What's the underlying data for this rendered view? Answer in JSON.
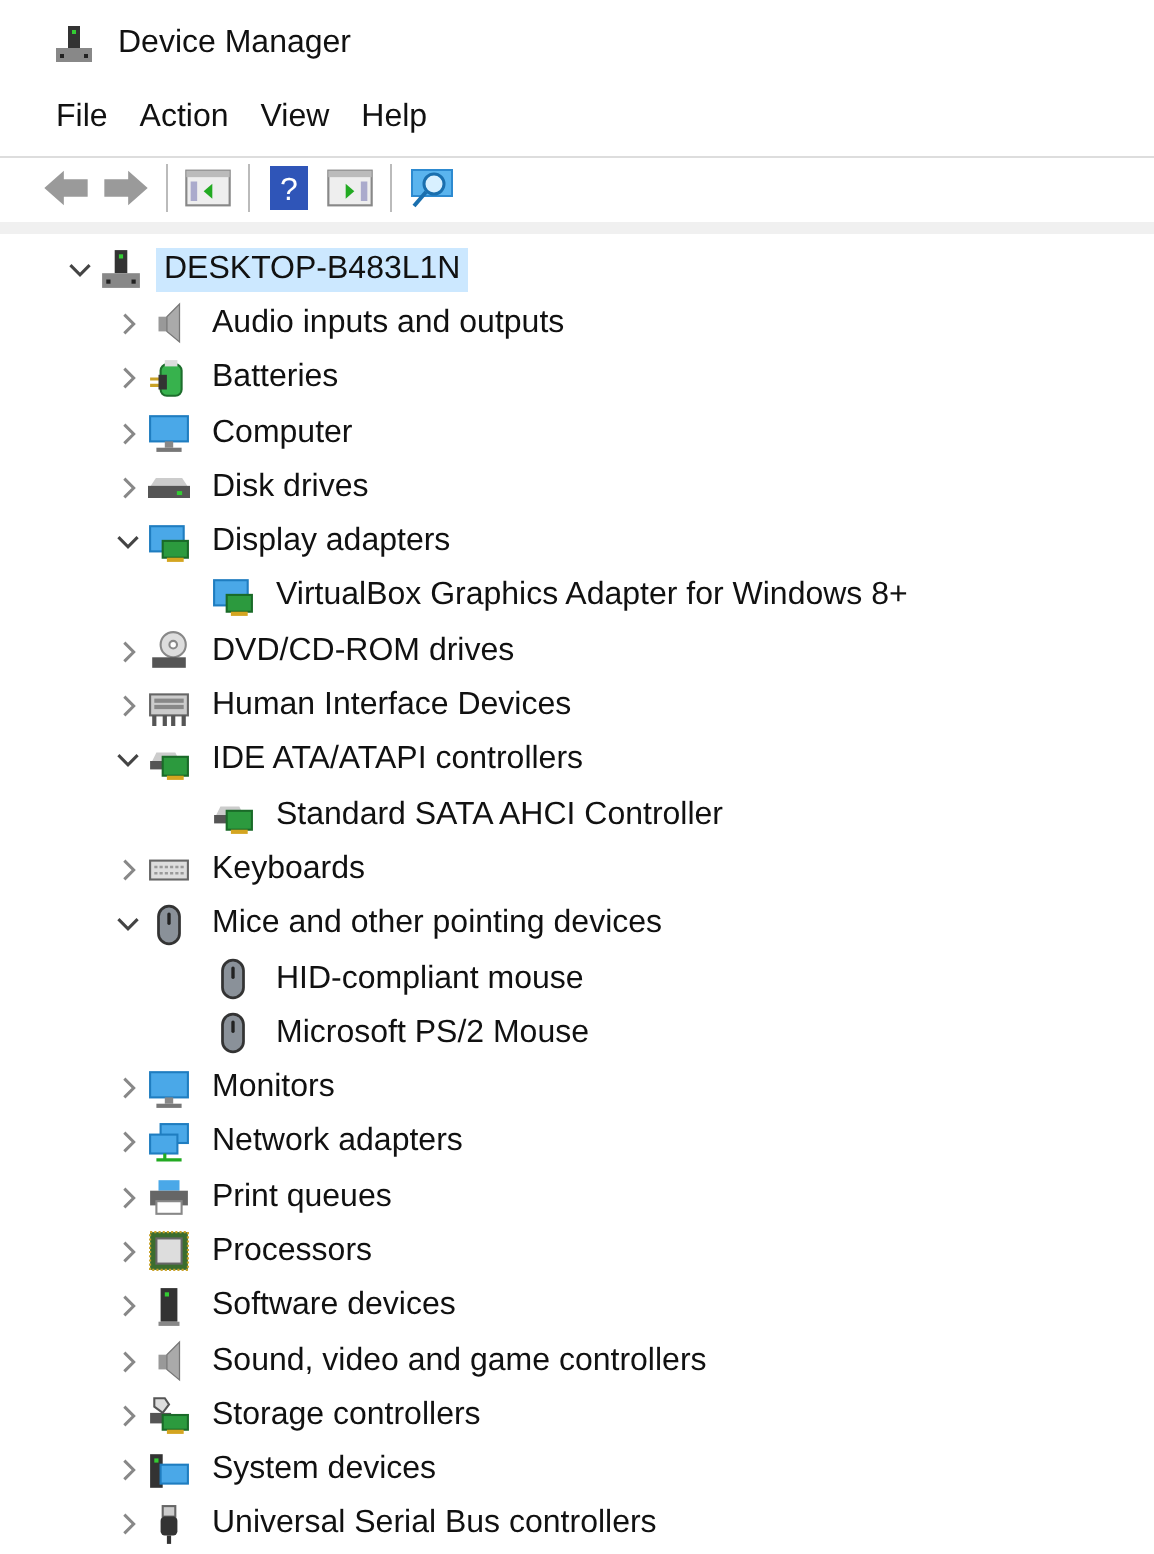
{
  "window": {
    "title": "Device Manager"
  },
  "menu": [
    "File",
    "Action",
    "View",
    "Help"
  ],
  "toolbar": {
    "help_glyph": "?"
  },
  "tree": {
    "label": "DESKTOP-B483L1N",
    "kind": "computer",
    "expanded": true,
    "selected": true,
    "children": [
      {
        "label": "Audio inputs and outputs",
        "kind": "audio",
        "expanded": false,
        "selected": false
      },
      {
        "label": "Batteries",
        "kind": "battery",
        "expanded": false,
        "selected": false
      },
      {
        "label": "Computer",
        "kind": "monitor",
        "expanded": false,
        "selected": false
      },
      {
        "label": "Disk drives",
        "kind": "disk",
        "expanded": false,
        "selected": false
      },
      {
        "label": "Display adapters",
        "kind": "display",
        "expanded": true,
        "selected": false,
        "children": [
          {
            "label": "VirtualBox Graphics Adapter for Windows 8+",
            "kind": "display",
            "selected": false
          }
        ]
      },
      {
        "label": "DVD/CD-ROM drives",
        "kind": "dvd",
        "expanded": false,
        "selected": false
      },
      {
        "label": "Human Interface Devices",
        "kind": "hid",
        "expanded": false,
        "selected": false
      },
      {
        "label": "IDE ATA/ATAPI controllers",
        "kind": "ide",
        "expanded": true,
        "selected": false,
        "children": [
          {
            "label": "Standard SATA AHCI Controller",
            "kind": "ide",
            "selected": false
          }
        ]
      },
      {
        "label": "Keyboards",
        "kind": "keyboard",
        "expanded": false,
        "selected": false
      },
      {
        "label": "Mice and other pointing devices",
        "kind": "mouse",
        "expanded": true,
        "selected": false,
        "children": [
          {
            "label": "HID-compliant mouse",
            "kind": "mouse",
            "selected": false
          },
          {
            "label": "Microsoft PS/2 Mouse",
            "kind": "mouse",
            "selected": false
          }
        ]
      },
      {
        "label": "Monitors",
        "kind": "monitor",
        "expanded": false,
        "selected": false
      },
      {
        "label": "Network adapters",
        "kind": "network",
        "expanded": false,
        "selected": false
      },
      {
        "label": "Print queues",
        "kind": "printer",
        "expanded": false,
        "selected": false
      },
      {
        "label": "Processors",
        "kind": "processor",
        "expanded": false,
        "selected": false
      },
      {
        "label": "Software devices",
        "kind": "software",
        "expanded": false,
        "selected": false
      },
      {
        "label": "Sound, video and game controllers",
        "kind": "audio",
        "expanded": false,
        "selected": false
      },
      {
        "label": "Storage controllers",
        "kind": "storage",
        "expanded": false,
        "selected": false
      },
      {
        "label": "System devices",
        "kind": "system",
        "expanded": false,
        "selected": false
      },
      {
        "label": "Universal Serial Bus controllers",
        "kind": "usb",
        "expanded": false,
        "selected": false
      }
    ]
  }
}
